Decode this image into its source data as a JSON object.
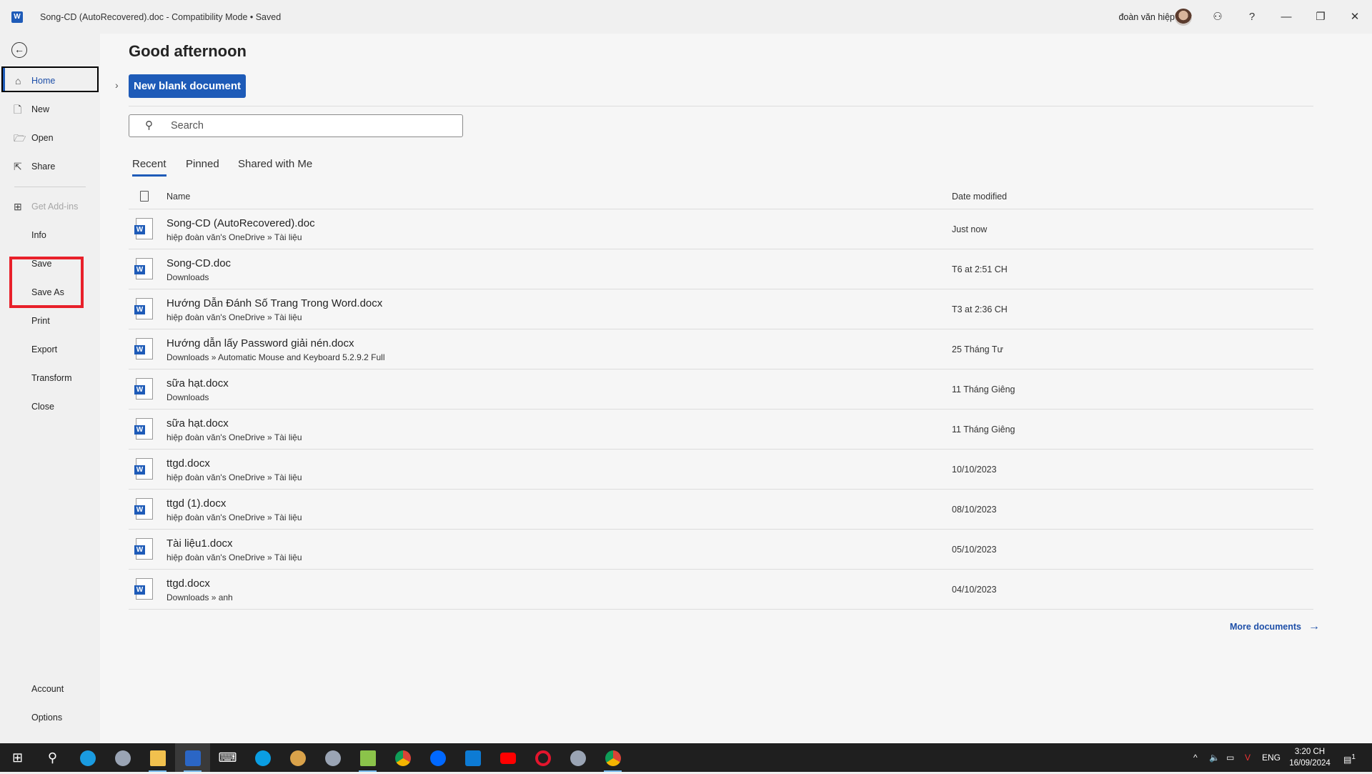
{
  "window": {
    "title": "Song-CD (AutoRecovered).doc  -  Compatibility Mode • Saved",
    "app_icon": "word-icon",
    "user_name": "đoàn văn hiệp",
    "controls": [
      "coauthor-icon",
      "help-icon",
      "minimize-icon",
      "restore-icon",
      "close-icon"
    ]
  },
  "sidebar": {
    "items": [
      {
        "label": "Home",
        "icon": "home-icon",
        "active": true
      },
      {
        "label": "New",
        "icon": "new-doc-icon"
      },
      {
        "label": "Open",
        "icon": "folder-open-icon"
      },
      {
        "label": "Share",
        "icon": "share-icon"
      },
      {
        "label": "Get Add-ins",
        "icon": "addins-icon",
        "disabled": true
      },
      {
        "label": "Info"
      },
      {
        "label": "Save"
      },
      {
        "label": "Save As"
      },
      {
        "label": "Print"
      },
      {
        "label": "Export"
      },
      {
        "label": "Transform"
      },
      {
        "label": "Close"
      }
    ],
    "bottom": [
      {
        "label": "Account"
      },
      {
        "label": "Options"
      }
    ],
    "highlight_color": "#e8202a"
  },
  "main": {
    "greeting": "Good afternoon",
    "new_blank": "New blank document",
    "search_placeholder": "Search",
    "tabs": [
      {
        "label": "Recent",
        "active": true
      },
      {
        "label": "Pinned"
      },
      {
        "label": "Shared with Me"
      }
    ],
    "columns": {
      "name": "Name",
      "date": "Date modified"
    },
    "files": [
      {
        "name": "Song-CD (AutoRecovered).doc",
        "location": "hiệp đoàn văn's OneDrive » Tài liệu",
        "date": "Just now"
      },
      {
        "name": "Song-CD.doc",
        "location": "Downloads",
        "date": "T6 at 2:51 CH"
      },
      {
        "name": "Hướng Dẫn Đánh Số Trang Trong Word.docx",
        "location": "hiệp đoàn văn's OneDrive » Tài liệu",
        "date": "T3 at 2:36 CH"
      },
      {
        "name": "Hướng dẫn lấy Password giải nén.docx",
        "location": "Downloads » Automatic Mouse and Keyboard 5.2.9.2 Full",
        "date": "25 Tháng Tư"
      },
      {
        "name": "sữa hạt.docx",
        "location": "Downloads",
        "date": "11 Tháng Giêng"
      },
      {
        "name": "sữa hạt.docx",
        "location": "hiệp đoàn văn's OneDrive » Tài liệu",
        "date": "11 Tháng Giêng"
      },
      {
        "name": "ttgd.docx",
        "location": "hiệp đoàn văn's OneDrive » Tài liệu",
        "date": "10/10/2023"
      },
      {
        "name": "ttgd (1).docx",
        "location": "hiệp đoàn văn's OneDrive » Tài liệu",
        "date": "08/10/2023"
      },
      {
        "name": "Tài liệu1.docx",
        "location": "hiệp đoàn văn's OneDrive » Tài liệu",
        "date": "05/10/2023"
      },
      {
        "name": "ttgd.docx",
        "location": "Downloads » anh",
        "date": "04/10/2023"
      }
    ],
    "more_documents": "More documents",
    "accent": "#1e5bb8"
  },
  "taskbar": {
    "apps": [
      "start-icon",
      "search-icon",
      "edge-icon",
      "app-icon",
      "file-explorer-icon",
      "word-icon",
      "keyboard-icon",
      "skype-icon",
      "paint-icon",
      "app-icon",
      "notepad-icon",
      "chrome-icon",
      "zalo-icon",
      "vscode-icon",
      "youtube-icon",
      "opera-icon",
      "app-icon",
      "chrome-profile-icon"
    ],
    "language": "ENG",
    "time": "3:20 CH",
    "date": "16/09/2024",
    "notifications": "1"
  }
}
